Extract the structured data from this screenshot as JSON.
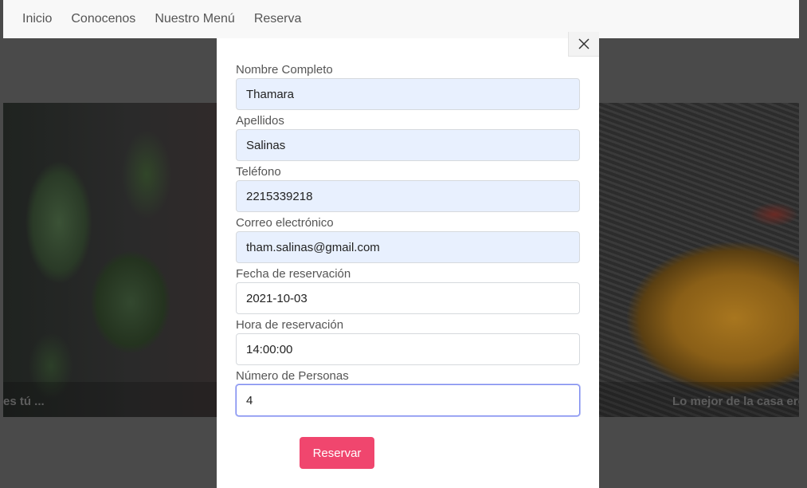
{
  "nav": {
    "items": [
      {
        "label": "Inicio"
      },
      {
        "label": "Conocenos"
      },
      {
        "label": "Nuestro Menú"
      },
      {
        "label": "Reserva"
      }
    ]
  },
  "carousel": {
    "caption_left": "es tú ...",
    "caption_right": "Lo mejor de la casa eres"
  },
  "modal": {
    "close_icon": "close-icon",
    "fields": [
      {
        "label": "Nombre Completo",
        "value": "Thamara"
      },
      {
        "label": "Apellidos",
        "value": "Salinas"
      },
      {
        "label": "Teléfono",
        "value": "2215339218"
      },
      {
        "label": "Correo electrónico",
        "value": "tham.salinas@gmail.com"
      },
      {
        "label": "Fecha de reservación",
        "value": "2021-10-03"
      },
      {
        "label": "Hora de reservación",
        "value": "14:00:00"
      },
      {
        "label": "Número de Personas",
        "value": "4"
      }
    ],
    "submit_label": "Reservar"
  },
  "colors": {
    "accent": "#f0466e",
    "autofill_bg": "#e8f0fe",
    "focus_border": "#7e8cf0"
  }
}
